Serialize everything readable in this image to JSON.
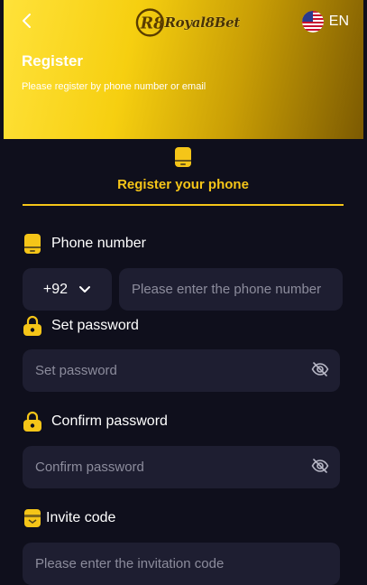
{
  "header": {
    "brand": "Royal8Bet",
    "language": "EN",
    "title": "Register",
    "subtitle": "Please register by phone number or email"
  },
  "tab": {
    "label": "Register your phone"
  },
  "form": {
    "phone_label": "Phone number",
    "country_code": "+92",
    "phone_placeholder": "Please enter the phone number",
    "password_label": "Set password",
    "password_placeholder": "Set password",
    "confirm_label": "Confirm password",
    "confirm_placeholder": "Confirm password",
    "invite_label": "Invite code",
    "invite_placeholder": "Please enter the invitation code"
  },
  "colors": {
    "accent": "#f5c518",
    "background": "#0f0f1c",
    "field": "#1e1e31"
  },
  "icons": [
    "back-arrow-icon",
    "us-flag-icon",
    "phone-icon",
    "lock-icon",
    "eye-slash-icon",
    "gift-icon",
    "chevron-down-icon"
  ]
}
